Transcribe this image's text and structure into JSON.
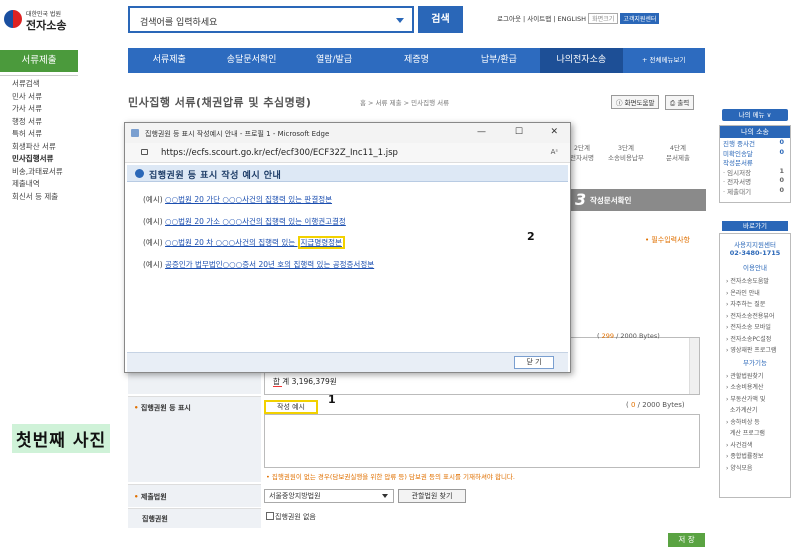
{
  "logo": {
    "small": "대한민국 법원",
    "big": "전자소송"
  },
  "search": {
    "placeholder": "검색어를 입력하세요",
    "button": "검색"
  },
  "util": {
    "login": "로그아웃",
    "sitemap": "사이트맵",
    "english": "ENGLISH",
    "size": "화면크기",
    "customer": "고객지원센터"
  },
  "topnav": [
    "서류제출",
    "송달문서확인",
    "열람/발급",
    "제증명",
    "납부/환급",
    "나의전자소송",
    "+ 전체메뉴보기"
  ],
  "leftnav": {
    "title": "서류제출",
    "items": [
      "서류검색",
      "민사 서류",
      "가사 서류",
      "행정 서류",
      "특허 서류",
      "회생파산 서류",
      "민사집행서류",
      "비송,과태료서류",
      "제출내역",
      "회신서 등 제출"
    ]
  },
  "page": {
    "title": "민사집행 서류(채권압류 및 추심명령)",
    "breadcrumb": "홈 > 서류 제출 > 민사집행 서류",
    "help": "화면도움말",
    "print": "출력"
  },
  "right": {
    "mymenu": "나의 메뉴 ∨",
    "my_case": "나의 소송",
    "rows": [
      {
        "label": "진행 중사건",
        "count": "0"
      },
      {
        "label": "미확인송달",
        "count": "0"
      },
      {
        "label": "작성문서류",
        "count": ""
      },
      {
        "label": "· 임시저장",
        "count": "1"
      },
      {
        "label": "· 전자서명",
        "count": "0"
      },
      {
        "label": "· 제출대기",
        "count": "0"
      }
    ],
    "quick": "바로가기",
    "center_name": "사용지지원센터",
    "phone": "02-3480-1715",
    "guide": "이용안내",
    "links1": [
      "전자소송도움말",
      "온라인 안내",
      "자주하는 질문",
      "전자소송전용뷰어",
      "전자소송 모바일",
      "전자소송PC설정",
      "영상재판 프로그램"
    ],
    "sub": "부가기능",
    "links2": [
      "관할법원찾기",
      "소송비용계산",
      "부동산가액 및",
      "소가계산기",
      "송하비상 등",
      "계산 프로그램",
      "사건검색",
      "종합법률정보",
      "양식모음"
    ]
  },
  "steps": {
    "s1a": "2단계",
    "s1b": "전자서명",
    "s2a": "3단계",
    "s2b": "소송비용납부",
    "s3a": "4단계",
    "s3b": "문서제출"
  },
  "step3": {
    "num": "3",
    "label": "작성문서확인"
  },
  "required_note": "• 필수입력사항",
  "form": {
    "counter1_val": "299",
    "counter1_total": " / 2000 Bytes)",
    "sum_text": "합 계 3,196,379원",
    "exec_label": "집행권원 등 표시",
    "example_btn": "작성 예시",
    "counter2_val": "0",
    "counter2_total": " / 2000 Bytes)",
    "note": "• 집행권원이 없는 경우(담보권실행을 위한 압류 등) 담보권 등의 표시를 기재하셔야 합니다.",
    "court_label": "제출법원",
    "court_value": "서울중앙지방법원",
    "court_find": "관할법원 찾기",
    "title_label": "집행권원",
    "checkbox_label": "집행권원 없음",
    "next": "저 장"
  },
  "annotations": {
    "one": "1",
    "two": "2",
    "caption": "첫번째 사진"
  },
  "popup": {
    "window_title": "집행권원 등 표시 작성예시 안내 - 프로필 1 - Microsoft Edge",
    "url": "https://ecfs.scourt.go.kr/ecf/ecf300/ECF32Z_Inc11_1.jsp",
    "aa": "Aˢ",
    "header": "집행권원 등 표시 작성 예시 안내",
    "examples": [
      {
        "prefix": "(예시) ",
        "text": "○○법원 20 가단 ○○○사건의 집행력 있는 판결정본",
        "tail": ""
      },
      {
        "prefix": "(예시) ",
        "text": "○○법원 20 가소 ○○○사건의 집행력 있는 이행권고결정",
        "tail": ""
      },
      {
        "prefix": "(예시) ",
        "text": "○○법원 20 차 ○○○사건의 집행력 있는 ",
        "tail": "지급명령정본"
      },
      {
        "prefix": "(예시) ",
        "text": "공증인가 법무법인○○○증서 20년 호의 집행력 있는 공정증서정본",
        "tail": ""
      }
    ],
    "close": "닫 기"
  }
}
